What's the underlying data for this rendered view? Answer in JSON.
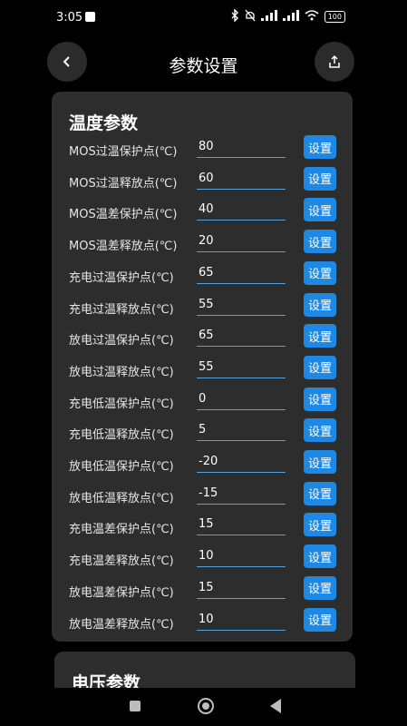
{
  "status": {
    "time": "3:05",
    "battery": "100"
  },
  "header": {
    "title": "参数设置"
  },
  "temperature": {
    "title": "温度参数",
    "set_label": "设置",
    "rows": [
      {
        "label": "MOS过温保护点(℃)",
        "value": "80"
      },
      {
        "label": "MOS过温释放点(℃)",
        "value": "60"
      },
      {
        "label": "MOS温差保护点(℃)",
        "value": "40"
      },
      {
        "label": "MOS温差释放点(℃)",
        "value": "20"
      },
      {
        "label": "充电过温保护点(℃)",
        "value": "65"
      },
      {
        "label": "充电过温释放点(℃)",
        "value": "55"
      },
      {
        "label": "放电过温保护点(℃)",
        "value": "65"
      },
      {
        "label": "放电过温释放点(℃)",
        "value": "55"
      },
      {
        "label": "充电低温保护点(℃)",
        "value": "0"
      },
      {
        "label": "充电低温释放点(℃)",
        "value": "5"
      },
      {
        "label": "放电低温保护点(℃)",
        "value": "-20"
      },
      {
        "label": "放电低温释放点(℃)",
        "value": "-15"
      },
      {
        "label": "充电温差保护点(℃)",
        "value": "15"
      },
      {
        "label": "充电温差释放点(℃)",
        "value": "10"
      },
      {
        "label": "放电温差保护点(℃)",
        "value": "15"
      },
      {
        "label": "放电温差释放点(℃)",
        "value": "10"
      }
    ]
  },
  "voltage": {
    "title": "电压参数"
  },
  "colors": {
    "accent": "#1e88e5",
    "card": "#2d2d2d",
    "background": "#000000"
  }
}
